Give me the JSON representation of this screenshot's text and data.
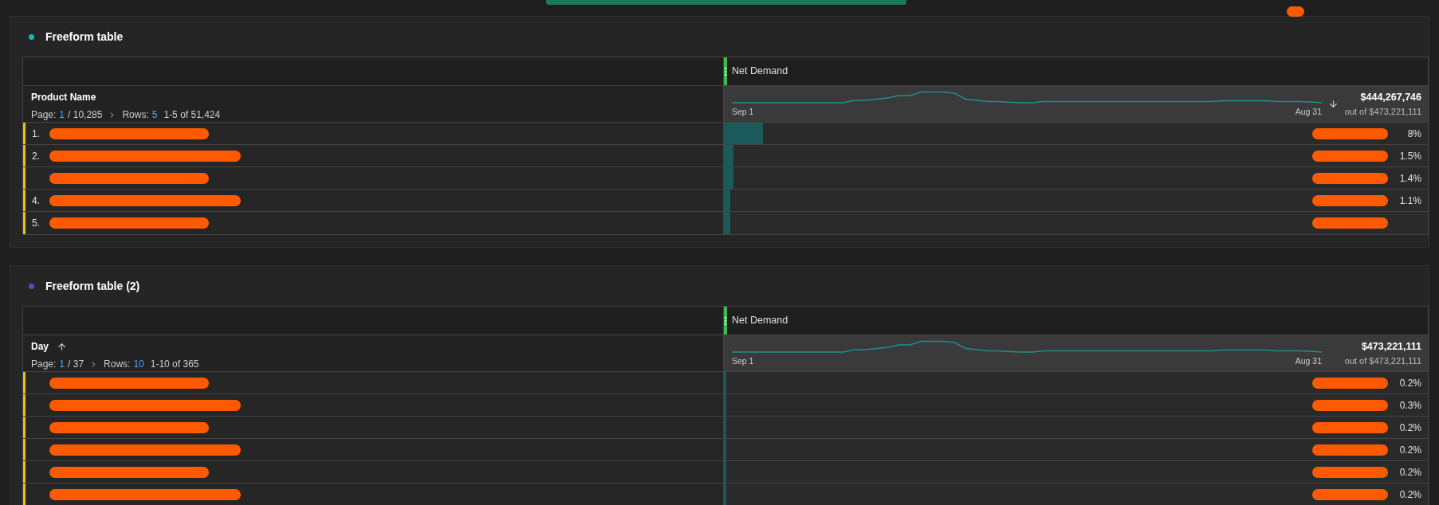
{
  "redaction_dot": true,
  "panels": [
    {
      "title": "Freeform table",
      "color": "#14b8b0",
      "dimension": {
        "name": "Product Name"
      },
      "pagination": {
        "page_label": "Page:",
        "page": "1",
        "pages": "/ 10,285",
        "rows_label": "Rows:",
        "rows": "5",
        "range": "1-5 of 51,424"
      },
      "metric": {
        "name": "Net Demand",
        "sorted_descending": true,
        "total": "$444,267,746",
        "out_of": "out of $473,221,111",
        "start": "Sep 1",
        "end": "Aug 31"
      },
      "rows": [
        {
          "label": "1.",
          "redacted": true,
          "pct": "8%",
          "level": 0.056
        },
        {
          "label": "2.",
          "redacted": true,
          "pct": "1.5%",
          "level": 0.014
        },
        {
          "redacted": true,
          "pct": "1.4%",
          "level": 0.014
        },
        {
          "label": "4.",
          "redacted": true,
          "pct": "1.1%",
          "level": 0.009
        },
        {
          "label": "5.",
          "redacted": true,
          "level": 0.009
        }
      ]
    },
    {
      "title": "Freeform table (2)",
      "color": "#5a48d0",
      "dimension": {
        "name": "Day",
        "sorted_ascending": true
      },
      "pagination": {
        "page_label": "Page:",
        "page": "1",
        "pages": "/ 37",
        "rows_label": "Rows:",
        "rows": "10",
        "range": "1-10 of 365"
      },
      "metric": {
        "name": "Net Demand",
        "total": "$473,221,111",
        "out_of": "out of $473,221,111",
        "start": "Sep 1",
        "end": "Aug 31"
      },
      "rows": [
        {
          "redacted": true,
          "pct": "0.2%",
          "level": 0.003
        },
        {
          "redacted": true,
          "pct": "0.3%",
          "level": 0.003
        },
        {
          "redacted": true,
          "pct": "0.2%",
          "level": 0.003
        },
        {
          "redacted": true,
          "pct": "0.2%",
          "level": 0.003
        },
        {
          "redacted": true,
          "pct": "0.2%",
          "level": 0.003
        },
        {
          "redacted": true,
          "pct": "0.2%",
          "level": 0.003
        }
      ]
    }
  ]
}
